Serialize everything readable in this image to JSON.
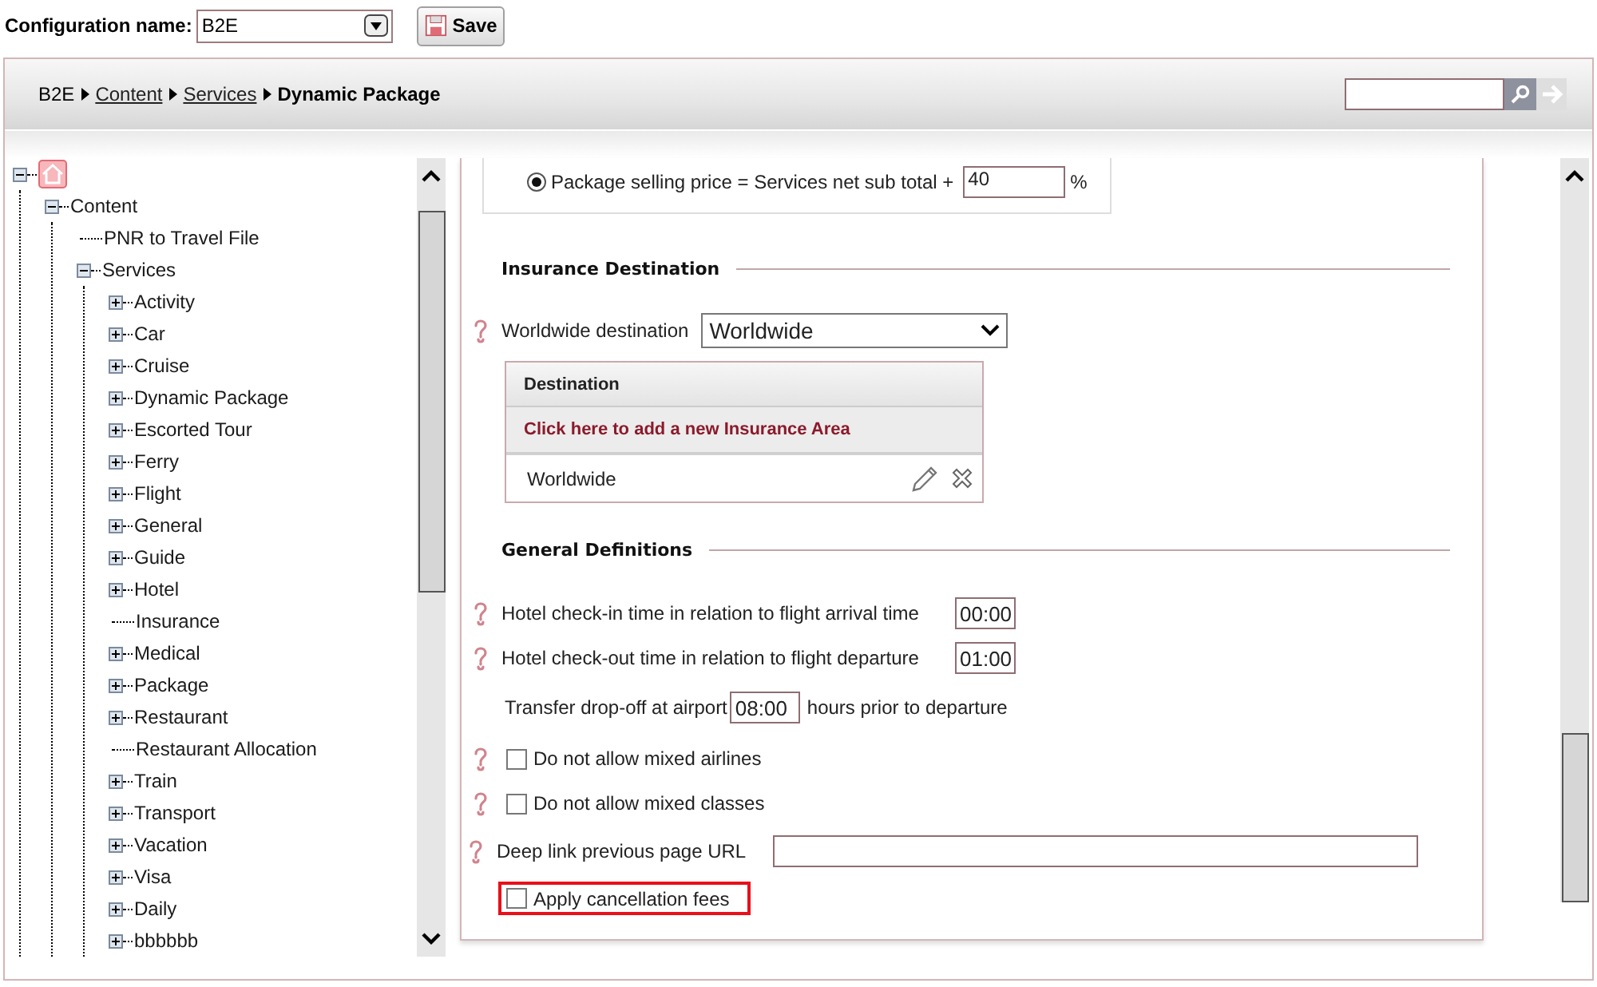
{
  "config": {
    "label": "Configuration name:",
    "value": "B2E"
  },
  "save_button": {
    "label": "Save"
  },
  "breadcrumb": [
    {
      "label": "B2E",
      "kind": "text"
    },
    {
      "label": "Content",
      "kind": "link"
    },
    {
      "label": "Services",
      "kind": "link"
    },
    {
      "label": "Dynamic Package",
      "kind": "current"
    }
  ],
  "tree": {
    "expanded": true,
    "children": [
      {
        "label": "Content",
        "kind": "branch",
        "expanded": true,
        "children": [
          {
            "label": "PNR to Travel File",
            "kind": "leaf"
          },
          {
            "label": "Services",
            "kind": "branch",
            "expanded": true,
            "children": [
              {
                "label": "Activity",
                "kind": "branch",
                "expanded": false
              },
              {
                "label": "Car",
                "kind": "branch",
                "expanded": false
              },
              {
                "label": "Cruise",
                "kind": "branch",
                "expanded": false
              },
              {
                "label": "Dynamic Package",
                "kind": "branch",
                "expanded": false
              },
              {
                "label": "Escorted Tour",
                "kind": "branch",
                "expanded": false
              },
              {
                "label": "Ferry",
                "kind": "branch",
                "expanded": false
              },
              {
                "label": "Flight",
                "kind": "branch",
                "expanded": false
              },
              {
                "label": "General",
                "kind": "branch",
                "expanded": false
              },
              {
                "label": "Guide",
                "kind": "branch",
                "expanded": false
              },
              {
                "label": "Hotel",
                "kind": "branch",
                "expanded": false
              },
              {
                "label": "Insurance",
                "kind": "leaf"
              },
              {
                "label": "Medical",
                "kind": "branch",
                "expanded": false
              },
              {
                "label": "Package",
                "kind": "branch",
                "expanded": false
              },
              {
                "label": "Restaurant",
                "kind": "branch",
                "expanded": false
              },
              {
                "label": "Restaurant Allocation",
                "kind": "leaf"
              },
              {
                "label": "Train",
                "kind": "branch",
                "expanded": false
              },
              {
                "label": "Transport",
                "kind": "branch",
                "expanded": false
              },
              {
                "label": "Vacation",
                "kind": "branch",
                "expanded": false
              },
              {
                "label": "Visa",
                "kind": "branch",
                "expanded": false
              },
              {
                "label": "Daily",
                "kind": "branch",
                "expanded": false
              },
              {
                "label": "bbbbbb",
                "kind": "branch",
                "expanded": false
              }
            ]
          }
        ]
      }
    ]
  },
  "pricing": {
    "label": "Package selling price = Services net sub total +",
    "selected": true,
    "value": "40",
    "unit": "%"
  },
  "insurance_destination": {
    "heading": "Insurance Destination",
    "field": {
      "label": "Worldwide destination",
      "value": "Worldwide",
      "help": true
    },
    "table": {
      "column": "Destination",
      "add_link": "Click here to add a new Insurance Area",
      "rows": [
        {
          "name": "Worldwide"
        }
      ]
    }
  },
  "general_definitions": {
    "heading": "General Definitions",
    "fields": [
      {
        "kind": "time",
        "label": "Hotel check-in time in relation to flight arrival time",
        "value": "00:00",
        "help": true
      },
      {
        "kind": "time",
        "label": "Hotel check-out time in relation to flight departure",
        "value": "01:00",
        "help": true
      },
      {
        "kind": "inline-time",
        "label": "Transfer drop-off at airport",
        "value": "08:00",
        "suffix": "hours prior to departure",
        "help": false
      },
      {
        "kind": "checkbox",
        "label": "Do not allow mixed airlines",
        "checked": false,
        "help": true,
        "highlighted": false
      },
      {
        "kind": "checkbox",
        "label": "Do not allow mixed classes",
        "checked": false,
        "help": true,
        "highlighted": false
      },
      {
        "kind": "text",
        "label": "Deep link previous page URL",
        "help": true
      },
      {
        "kind": "checkbox",
        "label": "Apply cancellation fees",
        "checked": false,
        "help": false,
        "highlighted": true
      }
    ]
  }
}
